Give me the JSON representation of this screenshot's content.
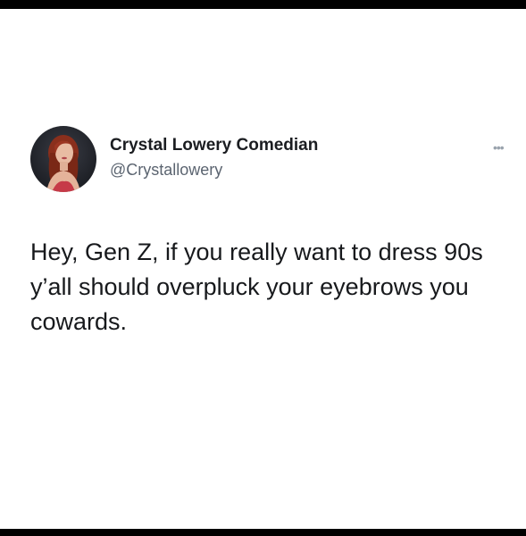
{
  "tweet": {
    "author": {
      "name": "Crystal Lowery Comedian",
      "handle": "@Crystallowery",
      "avatar": "profile-photo"
    },
    "text": "Hey, Gen Z, if you really want to dress 90s y’all should overpluck your eyebrows you cowards.",
    "more_icon": "more-options-icon"
  },
  "colors": {
    "page_background": "#ffffff",
    "outer_border": "#000000",
    "name_text": "#1b1d21",
    "handle_text": "#5b6470",
    "body_text": "#17191c"
  }
}
